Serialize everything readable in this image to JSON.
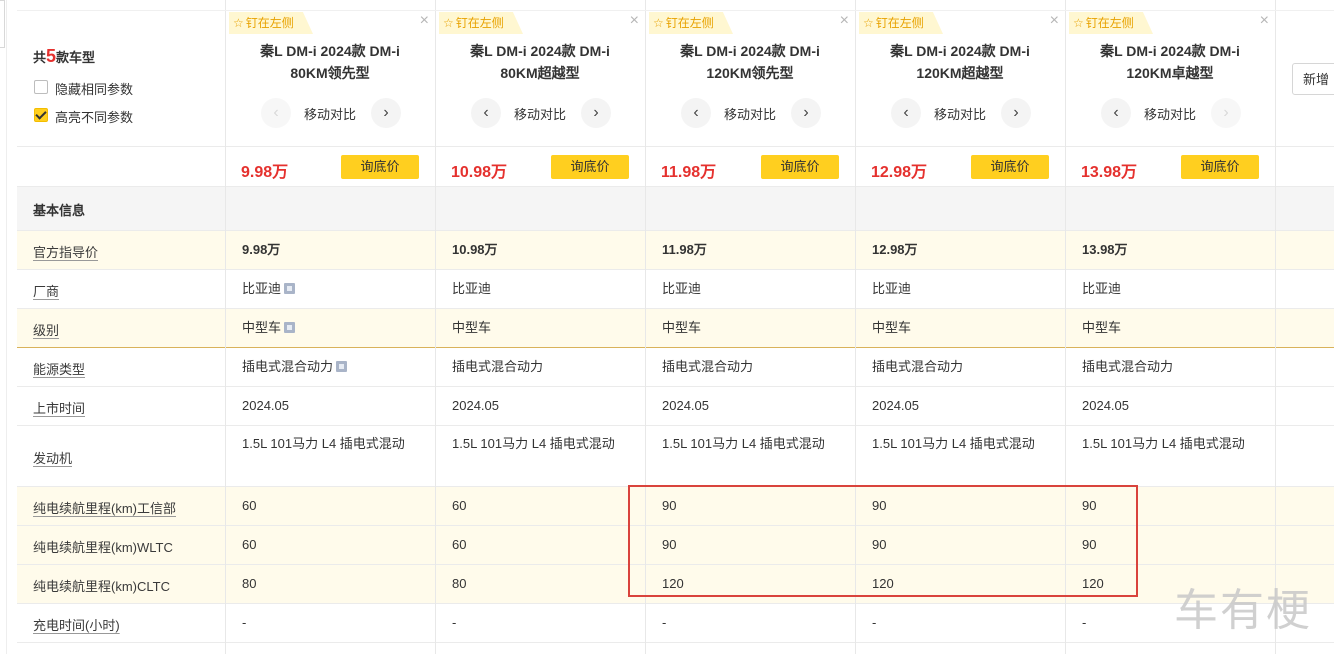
{
  "summary": {
    "prefix": "共",
    "count": "5",
    "suffix": "款车型",
    "hide_same": "隐藏相同参数",
    "highlight_diff": "高亮不同参数",
    "hide_same_checked": false,
    "highlight_diff_checked": true
  },
  "pin_label": "钉在左侧",
  "move_label": "移动对比",
  "ask_label": "询底价",
  "add_button": "新增",
  "section_title": "基本信息",
  "cars": [
    {
      "name": "秦L DM-i 2024款 DM-i 80KM领先型",
      "price": "9.98万"
    },
    {
      "name": "秦L DM-i 2024款 DM-i 80KM超越型",
      "price": "10.98万"
    },
    {
      "name": "秦L DM-i 2024款 DM-i 120KM领先型",
      "price": "11.98万"
    },
    {
      "name": "秦L DM-i 2024款 DM-i 120KM超越型",
      "price": "12.98万"
    },
    {
      "name": "秦L DM-i 2024款 DM-i 120KM卓越型",
      "price": "13.98万"
    }
  ],
  "rows": [
    {
      "label": "官方指导价",
      "values": [
        "9.98万",
        "10.98万",
        "11.98万",
        "12.98万",
        "13.98万"
      ]
    },
    {
      "label": "厂商",
      "values": [
        "比亚迪",
        "比亚迪",
        "比亚迪",
        "比亚迪",
        "比亚迪"
      ]
    },
    {
      "label": "级别",
      "values": [
        "中型车",
        "中型车",
        "中型车",
        "中型车",
        "中型车"
      ]
    },
    {
      "label": "能源类型",
      "values": [
        "插电式混合动力",
        "插电式混合动力",
        "插电式混合动力",
        "插电式混合动力",
        "插电式混合动力"
      ]
    },
    {
      "label": "上市时间",
      "values": [
        "2024.05",
        "2024.05",
        "2024.05",
        "2024.05",
        "2024.05"
      ]
    },
    {
      "label": "发动机",
      "values": [
        "1.5L 101马力 L4 插电式混动",
        "1.5L 101马力 L4 插电式混动",
        "1.5L 101马力 L4 插电式混动",
        "1.5L 101马力 L4 插电式混动",
        "1.5L 101马力 L4 插电式混动"
      ]
    },
    {
      "label": "纯电续航里程(km)工信部",
      "values": [
        "60",
        "60",
        "90",
        "90",
        "90"
      ]
    },
    {
      "label": "纯电续航里程(km)WLTC",
      "values": [
        "60",
        "60",
        "90",
        "90",
        "90"
      ]
    },
    {
      "label": "纯电续航里程(km)CLTC",
      "values": [
        "80",
        "80",
        "120",
        "120",
        "120"
      ]
    },
    {
      "label": "充电时间(小时)",
      "values": [
        "-",
        "-",
        "-",
        "-",
        "-"
      ]
    }
  ],
  "watermark": "车有梗",
  "colors": {
    "highlight_row": "#fffbeb",
    "price_red": "#e5312e",
    "ask_yellow": "#ffcf1f",
    "box_red": "#d9433c"
  }
}
